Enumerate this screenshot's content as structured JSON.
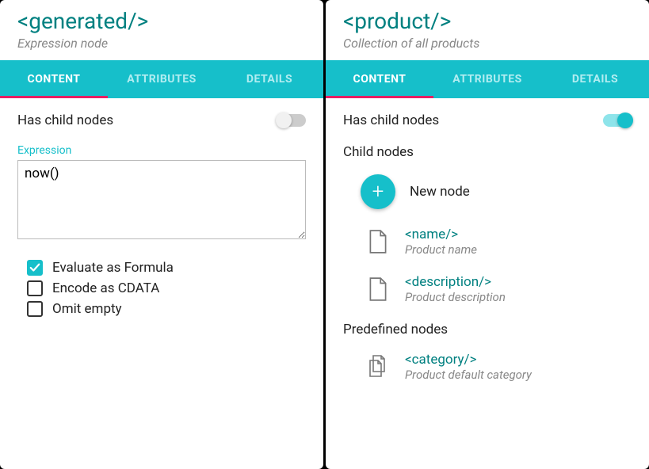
{
  "left": {
    "title": "<generated/>",
    "subtitle": "Expression node",
    "tabs": [
      "CONTENT",
      "ATTRIBUTES",
      "DETAILS"
    ],
    "has_child_label": "Has child nodes",
    "has_child_on": false,
    "expr_label": "Expression",
    "expr_value": "now()",
    "checks": [
      {
        "label": "Evaluate as Formula",
        "checked": true
      },
      {
        "label": "Encode as CDATA",
        "checked": false
      },
      {
        "label": "Omit empty",
        "checked": false
      }
    ]
  },
  "right": {
    "title": "<product/>",
    "subtitle": "Collection of all products",
    "tabs": [
      "CONTENT",
      "ATTRIBUTES",
      "DETAILS"
    ],
    "has_child_label": "Has child nodes",
    "has_child_on": true,
    "child_section": "Child nodes",
    "new_node": "New node",
    "children": [
      {
        "title": "<name/>",
        "sub": "Product name"
      },
      {
        "title": "<description/>",
        "sub": "Product description"
      }
    ],
    "predef_section": "Predefined nodes",
    "predef": [
      {
        "title": "<category/>",
        "sub": "Product default category"
      }
    ]
  }
}
